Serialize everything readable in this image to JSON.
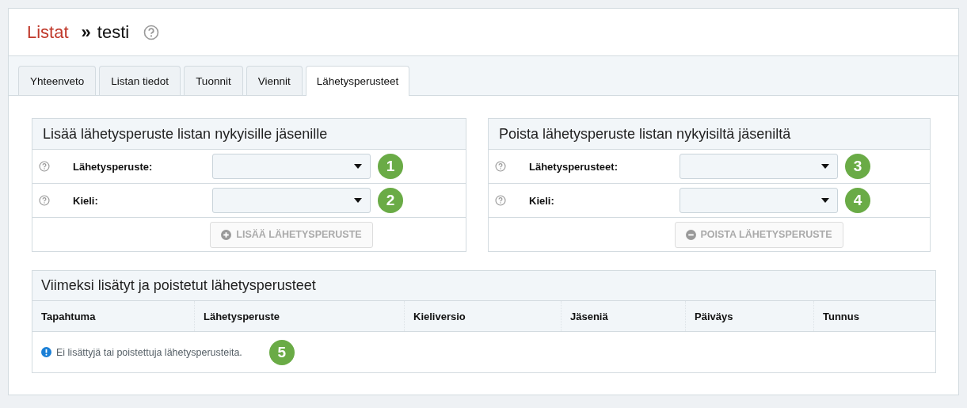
{
  "breadcrumb": {
    "parent": "Listat",
    "separator": "»",
    "current": "testi"
  },
  "tabs": [
    {
      "label": "Yhteenveto",
      "selected": false
    },
    {
      "label": "Listan tiedot",
      "selected": false
    },
    {
      "label": "Tuonnit",
      "selected": false
    },
    {
      "label": "Viennit",
      "selected": false
    },
    {
      "label": "Lähetysperusteet",
      "selected": true
    }
  ],
  "panels": [
    {
      "title": "Lisää lähetysperuste listan nykyisille jäsenille",
      "fields": [
        {
          "label": "Lähetysperuste:",
          "marker": "1"
        },
        {
          "label": "Kieli:",
          "marker": "2"
        }
      ],
      "button": {
        "label": "LISÄÄ LÄHETYSPERUSTE",
        "kind": "add",
        "disabled": true
      }
    },
    {
      "title": "Poista lähetysperuste listan nykyisiltä jäseniltä",
      "fields": [
        {
          "label": "Lähetysperusteet:",
          "marker": "3"
        },
        {
          "label": "Kieli:",
          "marker": "4"
        }
      ],
      "button": {
        "label": "POISTA LÄHETYSPERUSTE",
        "kind": "remove",
        "disabled": true
      }
    }
  ],
  "history": {
    "title": "Viimeksi lisätyt ja poistetut lähetysperusteet",
    "columns": [
      "Tapahtuma",
      "Lähetysperuste",
      "Kieliversio",
      "Jäseniä",
      "Päiväys",
      "Tunnus"
    ],
    "empty_message": "Ei lisättyjä tai poistettuja lähetysperusteita.",
    "marker": "5"
  }
}
